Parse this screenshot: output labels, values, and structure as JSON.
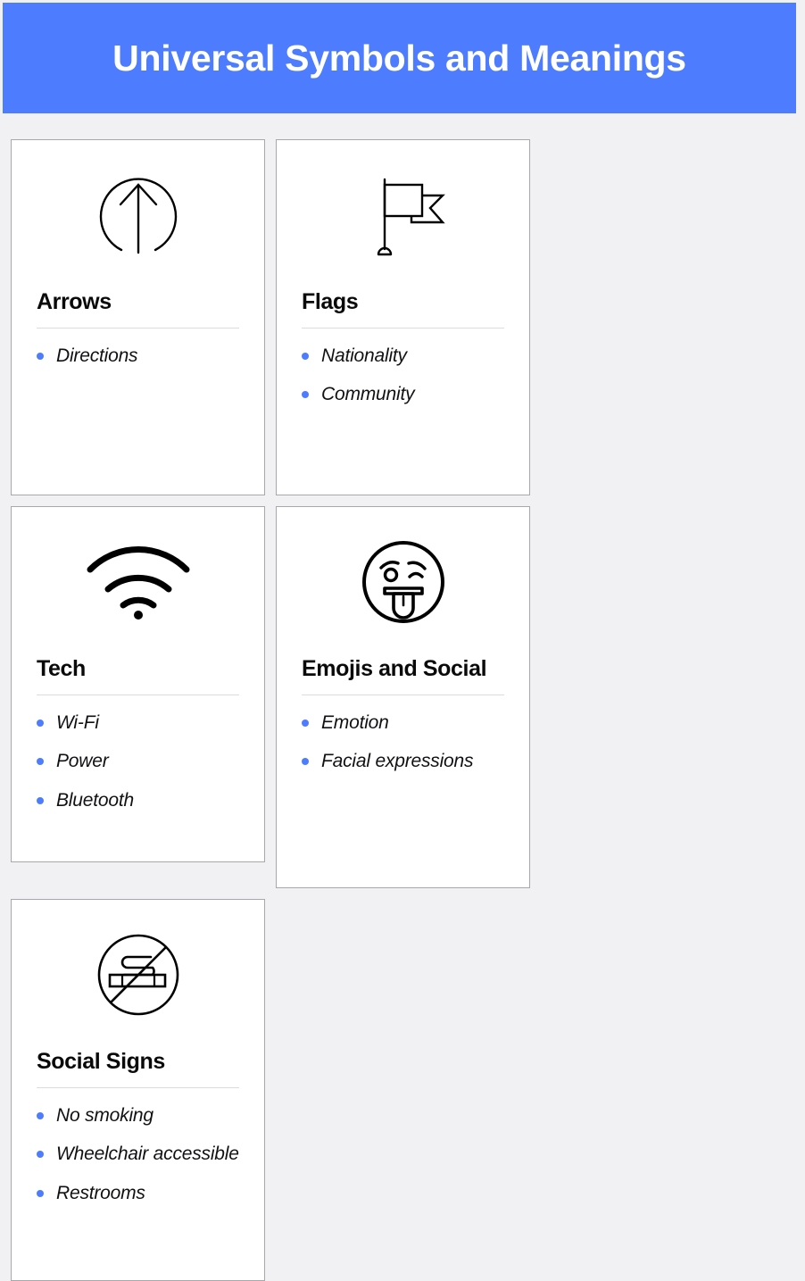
{
  "header": {
    "title": "Universal Symbols and Meanings",
    "background_color": "#4d7cfe",
    "text_color": "#ffffff"
  },
  "theme": {
    "page_background": "#f1f1f3",
    "card_background": "#ffffff",
    "card_border_color": "#a8a8ac",
    "accent_color": "#4d7cfe",
    "divider_color": "#dcdcde",
    "text_color": "#111114"
  },
  "cards": [
    {
      "icon": "arrow-up-in-circle-icon",
      "title": "Arrows",
      "bullets": [
        "Directions"
      ]
    },
    {
      "icon": "flag-icon",
      "title": "Flags",
      "bullets": [
        "Nationality",
        "Community"
      ]
    },
    {
      "icon": "wifi-icon",
      "title": "Tech",
      "bullets": [
        "Wi-Fi",
        "Power",
        "Bluetooth"
      ]
    },
    {
      "icon": "winking-face-tongue-icon",
      "title": "Emojis and Social",
      "bullets": [
        "Emotion",
        "Facial expressions"
      ]
    },
    {
      "icon": "no-smoking-icon",
      "title": "Social Signs",
      "bullets": [
        "No smoking",
        "Wheelchair accessible",
        "Restrooms"
      ]
    }
  ]
}
